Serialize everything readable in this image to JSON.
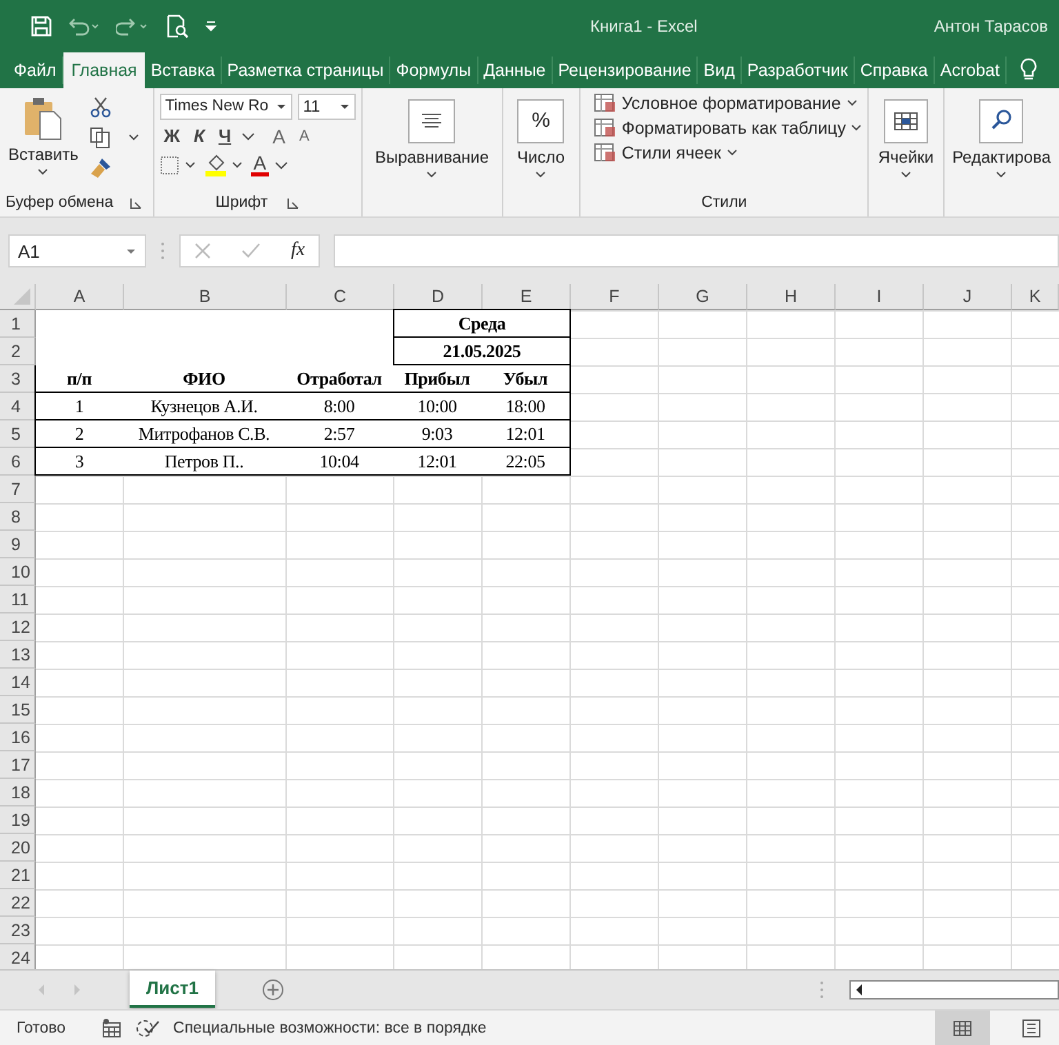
{
  "title_bar": {
    "title": "Книга1  -  Excel",
    "user": "Антон Тарасов"
  },
  "ribbon_tabs": [
    {
      "label": "Файл",
      "selected": false
    },
    {
      "label": "Главная",
      "selected": true
    },
    {
      "label": "Вставка",
      "selected": false
    },
    {
      "label": "Разметка страницы",
      "selected": false
    },
    {
      "label": "Формулы",
      "selected": false
    },
    {
      "label": "Данные",
      "selected": false
    },
    {
      "label": "Рецензирование",
      "selected": false
    },
    {
      "label": "Вид",
      "selected": false
    },
    {
      "label": "Разработчик",
      "selected": false
    },
    {
      "label": "Справка",
      "selected": false
    },
    {
      "label": "Acrobat",
      "selected": false
    }
  ],
  "clipboard": {
    "paste": "Вставить",
    "label": "Буфер обмена"
  },
  "font": {
    "name": "Times New Ro",
    "size": "11",
    "bold": "Ж",
    "italic": "К",
    "underline": "Ч",
    "grow": "A",
    "shrink": "A",
    "font_color_letter": "A",
    "label": "Шрифт"
  },
  "alignment": {
    "label": "Выравнивание"
  },
  "number": {
    "symbol": "%",
    "label": "Число"
  },
  "styles": {
    "items": [
      "Условное форматирование",
      "Форматировать как таблицу",
      "Стили ячеек"
    ],
    "label": "Стили"
  },
  "cells": {
    "label": "Ячейки"
  },
  "editing": {
    "label": "Редактирова"
  },
  "formula_bar": {
    "name_box": "A1",
    "fx": "fx"
  },
  "sheet": {
    "columns": [
      "A",
      "B",
      "C",
      "D",
      "E",
      "F",
      "G",
      "H",
      "I",
      "J",
      "K"
    ],
    "row_numbers": [
      "1",
      "2",
      "3",
      "4",
      "5",
      "6",
      "7",
      "8",
      "9",
      "10",
      "11",
      "12",
      "13",
      "14",
      "15",
      "16",
      "17",
      "18",
      "19",
      "20",
      "21",
      "22",
      "23",
      "24"
    ],
    "day": "Среда",
    "date": "21.05.2025",
    "headers": [
      "п/п",
      "ФИО",
      "Отработал",
      "Прибыл",
      "Убыл"
    ],
    "rows": [
      [
        "1",
        "Кузнецов А.И.",
        "8:00",
        "10:00",
        "18:00"
      ],
      [
        "2",
        "Митрофанов С.В.",
        "2:57",
        "9:03",
        "12:01"
      ],
      [
        "3",
        "Петров П..",
        "10:04",
        "12:01",
        "22:05"
      ]
    ]
  },
  "sheet_tabs": [
    {
      "label": "Лист1",
      "selected": true
    }
  ],
  "status_bar": {
    "ready": "Готово",
    "accessibility": "Специальные возможности: все в порядке",
    "views": [
      {
        "selected": true
      },
      {
        "selected": false
      }
    ]
  }
}
